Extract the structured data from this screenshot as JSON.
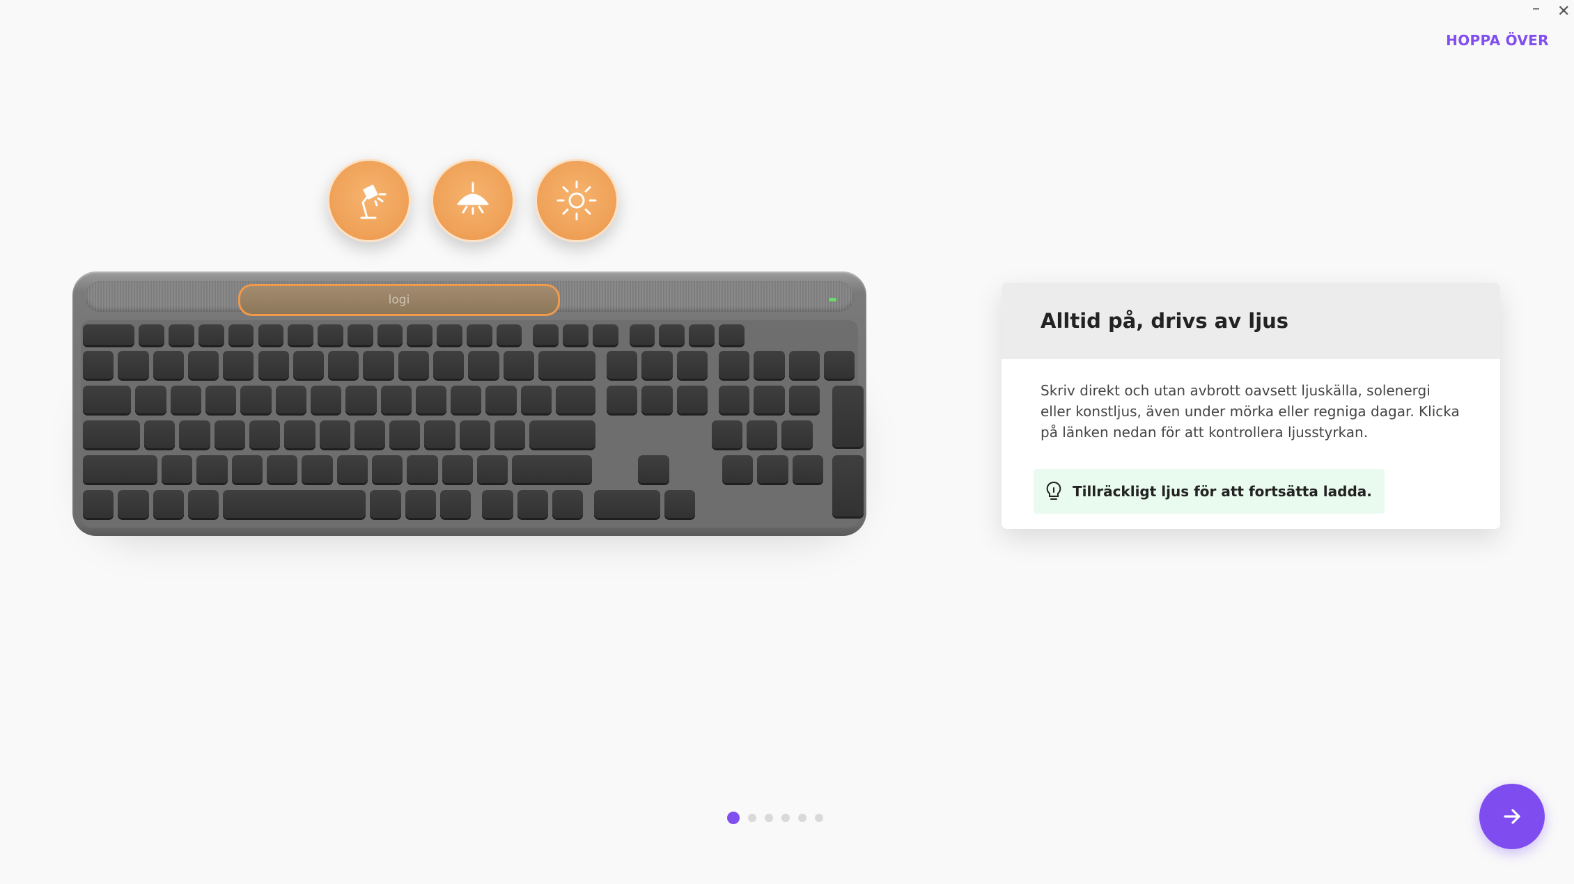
{
  "window": {
    "minimize_glyph": "–",
    "close_glyph": "✕"
  },
  "header": {
    "skip_label": "HOPPA ÖVER"
  },
  "light_sources": [
    {
      "icon": "desk-lamp-icon"
    },
    {
      "icon": "ceiling-lamp-icon"
    },
    {
      "icon": "sun-icon"
    }
  ],
  "keyboard": {
    "brand": "logi"
  },
  "info_card": {
    "title": "Alltid på, drivs av ljus",
    "description": "Skriv direkt och utan avbrott oavsett ljuskälla, solenergi eller konstljus, även under mörka eller regniga dagar. Klicka på länken nedan för att kontrollera ljusstyrkan.",
    "status_icon": "lightbulb-icon",
    "status_text": "Tillräckligt ljus för att fortsätta ladda."
  },
  "pager": {
    "total": 6,
    "current": 1
  },
  "colors": {
    "accent": "#814eef",
    "light_orange": "#f0a35a",
    "status_bg": "#e9fbef"
  },
  "next_icon": "arrow-right-icon"
}
